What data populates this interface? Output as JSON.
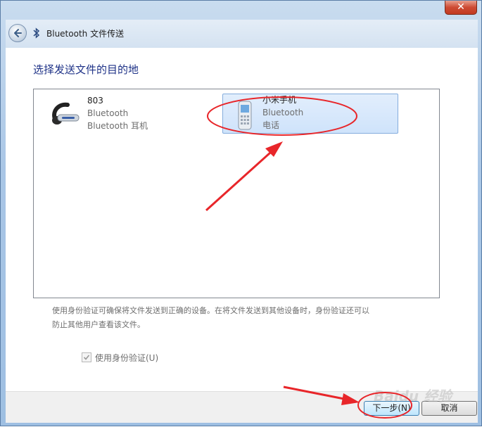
{
  "window": {
    "close_glyph": "✕"
  },
  "header": {
    "title": "Bluetooth 文件传送"
  },
  "main": {
    "heading": "选择发送文件的目的地",
    "devices": [
      {
        "name": "803",
        "type": "Bluetooth",
        "category": "Bluetooth 耳机",
        "icon": "headset-icon",
        "selected": false
      },
      {
        "name": "小米手机",
        "type": "Bluetooth",
        "category": "电话",
        "icon": "phone-icon",
        "selected": true
      }
    ],
    "note_line1": "使用身份验证可确保将文件发送到正确的设备。在将文件发送到其他设备时，身份验证还可以",
    "note_line2": "防止其他用户查看该文件。",
    "auth_checkbox": {
      "label": "使用身份验证(U)",
      "checked": true
    }
  },
  "footer": {
    "next_label": "下一步(N)",
    "cancel_label": "取消"
  },
  "watermark": "Baidu 经验",
  "colors": {
    "heading": "#1e3287",
    "selection": "#cfe3fb",
    "annotation": "#e8262a"
  }
}
